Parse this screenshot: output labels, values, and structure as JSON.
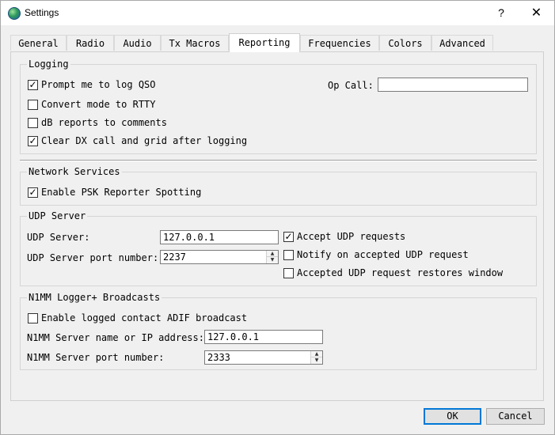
{
  "window": {
    "title": "Settings",
    "help_glyph": "?",
    "close_glyph": "✕",
    "icon": "globe-icon"
  },
  "tabs": [
    {
      "label": "General",
      "active": false
    },
    {
      "label": "Radio",
      "active": false
    },
    {
      "label": "Audio",
      "active": false
    },
    {
      "label": "Tx Macros",
      "active": false
    },
    {
      "label": "Reporting",
      "active": true
    },
    {
      "label": "Frequencies",
      "active": false
    },
    {
      "label": "Colors",
      "active": false
    },
    {
      "label": "Advanced",
      "active": false
    }
  ],
  "logging": {
    "title": "Logging",
    "prompt_log": {
      "label": "Prompt me to log QSO",
      "checked": true
    },
    "convert_rtty": {
      "label": "Convert mode to RTTY",
      "checked": false
    },
    "db_reports": {
      "label": "dB reports to comments",
      "checked": false
    },
    "clear_dx": {
      "label": "Clear DX call and grid after logging",
      "checked": true
    },
    "op_call_label": "Op Call:",
    "op_call_value": ""
  },
  "network": {
    "title": "Network Services",
    "psk_reporter": {
      "label": "Enable PSK Reporter Spotting",
      "checked": true
    }
  },
  "udp": {
    "title": "UDP Server",
    "server_label": "UDP Server:",
    "server_value": "127.0.0.1",
    "port_label": "UDP Server port number:",
    "port_value": "2237",
    "accept_requests": {
      "label": "Accept UDP requests",
      "checked": true
    },
    "notify_accepted": {
      "label": "Notify on accepted UDP request",
      "checked": false
    },
    "restores_window": {
      "label": "Accepted UDP request restores window",
      "checked": false
    }
  },
  "n1mm": {
    "title": "N1MM Logger+  Broadcasts",
    "enable_adif": {
      "label": "Enable logged contact ADIF broadcast",
      "checked": false
    },
    "server_label": "N1MM Server name or IP address:",
    "server_value": "127.0.0.1",
    "port_label": "N1MM Server port number:",
    "port_value": "2333"
  },
  "buttons": {
    "ok": "OK",
    "cancel": "Cancel"
  },
  "glyphs": {
    "check": "✓",
    "spin_up": "▲",
    "spin_down": "▼"
  }
}
